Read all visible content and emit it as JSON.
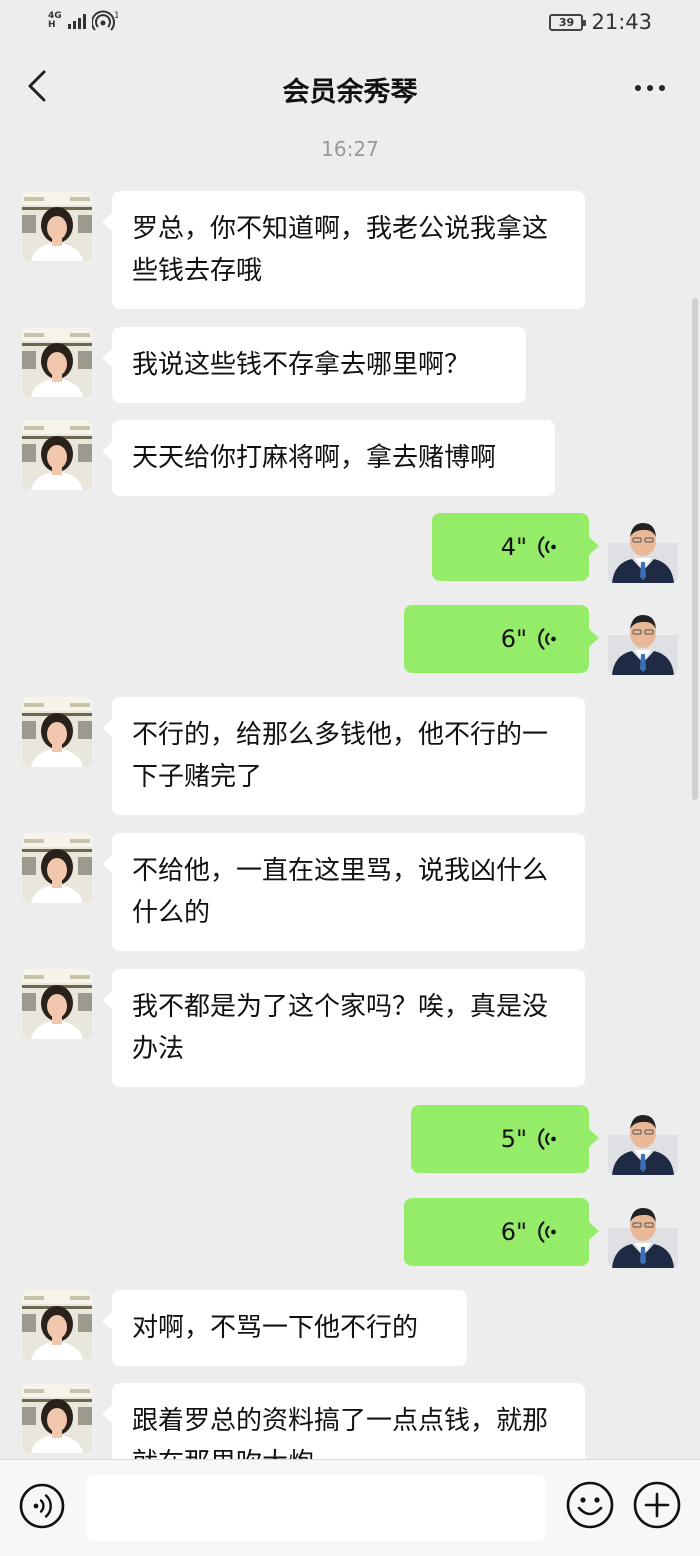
{
  "status_bar": {
    "network_top": "4G",
    "network_bottom": "H",
    "hotspot_count": "1",
    "battery": "39",
    "time": "21:43"
  },
  "header": {
    "title": "会员余秀琴",
    "back_icon": "chevron-left-icon",
    "more_icon": "more-dots-icon"
  },
  "chat": {
    "timestamp": "16:27",
    "messages": [
      {
        "side": "in",
        "type": "text",
        "text": "罗总，你不知道啊，我老公说我拿这些钱去存哦"
      },
      {
        "side": "in",
        "type": "text",
        "text": "我说这些钱不存拿去哪里啊？"
      },
      {
        "side": "in",
        "type": "text",
        "text": "天天给你打麻将啊，拿去赌博啊"
      },
      {
        "side": "out",
        "type": "voice",
        "duration": "4\""
      },
      {
        "side": "out",
        "type": "voice",
        "duration": "6\""
      },
      {
        "side": "in",
        "type": "text",
        "text": "不行的，给那么多钱他，他不行的一下子赌完了"
      },
      {
        "side": "in",
        "type": "text",
        "text": "不给他，一直在这里骂，说我凶什么什么的"
      },
      {
        "side": "in",
        "type": "text",
        "text": "我不都是为了这个家吗？唉，真是没办法"
      },
      {
        "side": "out",
        "type": "voice",
        "duration": "5\""
      },
      {
        "side": "out",
        "type": "voice",
        "duration": "6\""
      },
      {
        "side": "in",
        "type": "text",
        "text": "对啊，不骂一下他不行的"
      },
      {
        "side": "in",
        "type": "text",
        "text": "跟着罗总的资料搞了一点点钱，就那就在那里吹大炮"
      }
    ]
  },
  "input_bar": {
    "voice_icon": "voice-input-icon",
    "emoji_icon": "emoji-icon",
    "plus_icon": "plus-icon",
    "text_value": ""
  },
  "colors": {
    "background": "#ededed",
    "incoming_bubble": "#ffffff",
    "outgoing_bubble": "#95ec69"
  }
}
